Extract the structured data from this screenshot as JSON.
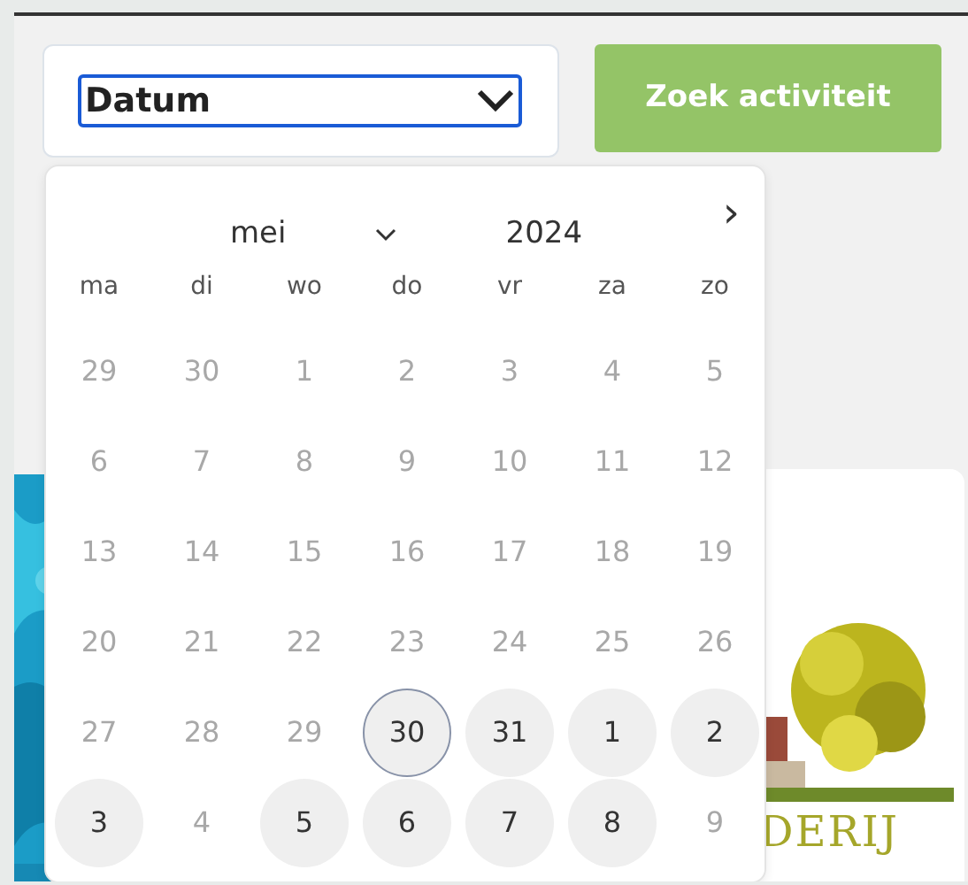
{
  "date_select": {
    "value": "Datum"
  },
  "search_button": {
    "label": "Zoek activiteit"
  },
  "datepicker": {
    "month": "mei",
    "year": "2024",
    "next": "›",
    "weekdays": [
      "ma",
      "di",
      "wo",
      "do",
      "vr",
      "za",
      "zo"
    ],
    "days": [
      {
        "label": "29",
        "kind": "muted"
      },
      {
        "label": "30",
        "kind": "muted"
      },
      {
        "label": "1",
        "kind": "muted"
      },
      {
        "label": "2",
        "kind": "muted"
      },
      {
        "label": "3",
        "kind": "muted"
      },
      {
        "label": "4",
        "kind": "muted"
      },
      {
        "label": "5",
        "kind": "muted"
      },
      {
        "label": "6",
        "kind": "muted"
      },
      {
        "label": "7",
        "kind": "muted"
      },
      {
        "label": "8",
        "kind": "muted"
      },
      {
        "label": "9",
        "kind": "muted"
      },
      {
        "label": "10",
        "kind": "muted"
      },
      {
        "label": "11",
        "kind": "muted"
      },
      {
        "label": "12",
        "kind": "muted"
      },
      {
        "label": "13",
        "kind": "muted"
      },
      {
        "label": "14",
        "kind": "muted"
      },
      {
        "label": "15",
        "kind": "muted"
      },
      {
        "label": "16",
        "kind": "muted"
      },
      {
        "label": "17",
        "kind": "muted"
      },
      {
        "label": "18",
        "kind": "muted"
      },
      {
        "label": "19",
        "kind": "muted"
      },
      {
        "label": "20",
        "kind": "muted"
      },
      {
        "label": "21",
        "kind": "muted"
      },
      {
        "label": "22",
        "kind": "muted"
      },
      {
        "label": "23",
        "kind": "muted"
      },
      {
        "label": "24",
        "kind": "muted"
      },
      {
        "label": "25",
        "kind": "muted"
      },
      {
        "label": "26",
        "kind": "muted"
      },
      {
        "label": "27",
        "kind": "muted"
      },
      {
        "label": "28",
        "kind": "muted"
      },
      {
        "label": "29",
        "kind": "muted"
      },
      {
        "label": "30",
        "kind": "today"
      },
      {
        "label": "31",
        "kind": "available"
      },
      {
        "label": "1",
        "kind": "available"
      },
      {
        "label": "2",
        "kind": "available"
      },
      {
        "label": "3",
        "kind": "available"
      },
      {
        "label": "4",
        "kind": "muted"
      },
      {
        "label": "5",
        "kind": "available"
      },
      {
        "label": "6",
        "kind": "available"
      },
      {
        "label": "7",
        "kind": "available"
      },
      {
        "label": "8",
        "kind": "available"
      },
      {
        "label": "9",
        "kind": "muted"
      }
    ]
  },
  "card": {
    "logo_text": "DERIJ"
  }
}
